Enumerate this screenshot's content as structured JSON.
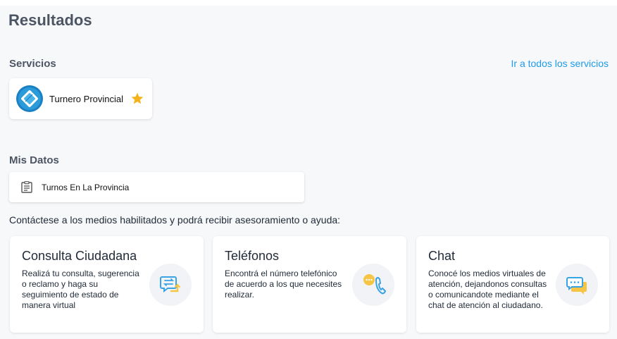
{
  "page": {
    "title": "Resultados"
  },
  "servicios": {
    "label": "Servicios",
    "link_all": "Ir a todos los servicios",
    "items": [
      {
        "name": "Turnero Provincial",
        "favorite": true,
        "icon": "turnero-logo"
      }
    ]
  },
  "mis_datos": {
    "label": "Mis Datos",
    "items": [
      {
        "label": "Turnos En La Provincia",
        "icon": "document-icon"
      }
    ]
  },
  "contacto": {
    "intro": "Contáctese a los medios habilitados y podrá recibir asesoramiento o ayuda:",
    "cards": [
      {
        "title": "Consulta Ciudadana",
        "description": "Realizá tu consulta, sugerencia o reclamo y haga su seguimiento de estado de manera virtual",
        "icon": "chat-exchange-icon"
      },
      {
        "title": "Teléfonos",
        "description": "Encontrá el número telefónico de acuerdo a los que necesites realizar.",
        "icon": "phone-icon"
      },
      {
        "title": "Chat",
        "description": "Conocé los medios virtuales de atención, dejandonos consultas o comunicandote mediante el chat de atención al ciudadano.",
        "icon": "chat-bubbles-icon"
      }
    ]
  },
  "colors": {
    "link": "#1e9be9",
    "star": "#f5b31b",
    "icon_blue": "#3aa3e3",
    "icon_yellow": "#f6c545",
    "logo_blue": "#1b7fc4"
  }
}
